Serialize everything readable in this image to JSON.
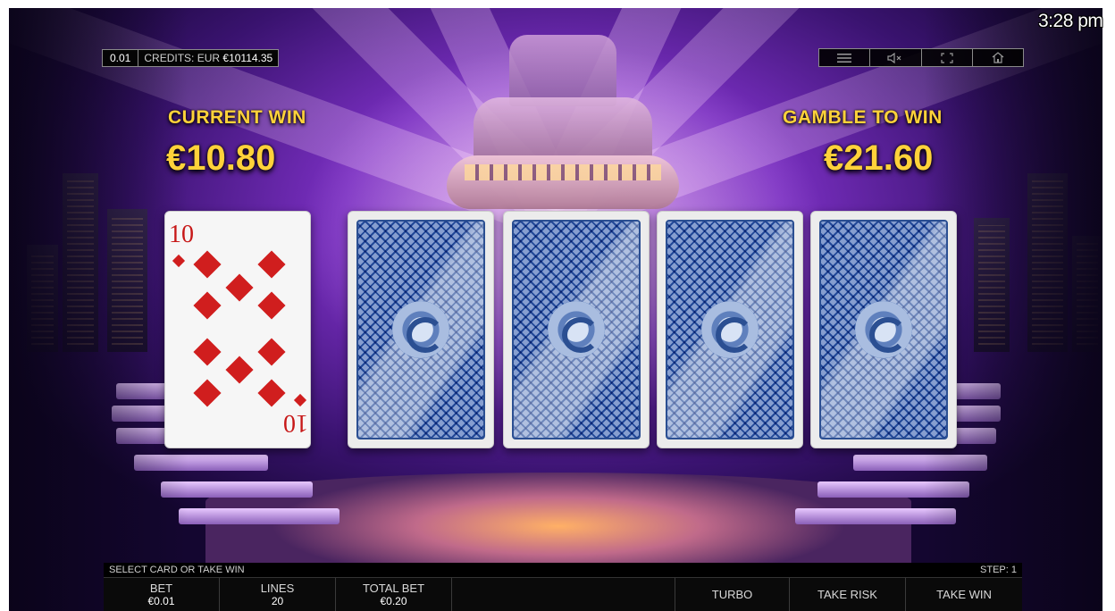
{
  "clock": "3:28 pm",
  "top_bar": {
    "denomination": "0.01",
    "credits_label": "CREDITS: EUR",
    "credits_value": "€10114.35",
    "menu_items": [
      "menu-icon",
      "sound-muted-icon",
      "fullscreen-icon",
      "home-icon"
    ]
  },
  "current_win": {
    "label": "CURRENT WIN",
    "value": "€10.80"
  },
  "gamble_to_win": {
    "label": "GAMBLE TO WIN",
    "value": "€21.60"
  },
  "cards": [
    {
      "state": "face-up",
      "rank": "10",
      "suit": "diamonds"
    },
    {
      "state": "face-down"
    },
    {
      "state": "face-down"
    },
    {
      "state": "face-down"
    },
    {
      "state": "face-down"
    }
  ],
  "status": {
    "message": "SELECT CARD OR TAKE WIN",
    "step": "STEP: 1"
  },
  "bottom_bar": {
    "bet_label": "BET",
    "bet_value": "€0.01",
    "lines_label": "LINES",
    "lines_value": "20",
    "total_bet_label": "TOTAL BET",
    "total_bet_value": "€0.20",
    "turbo": "TURBO",
    "take_risk": "TAKE RISK",
    "take_win": "TAKE WIN"
  },
  "colors": {
    "win_text": "#ffd23a",
    "card_back": "#2f5ca8",
    "suit_red": "#d01e1e"
  }
}
